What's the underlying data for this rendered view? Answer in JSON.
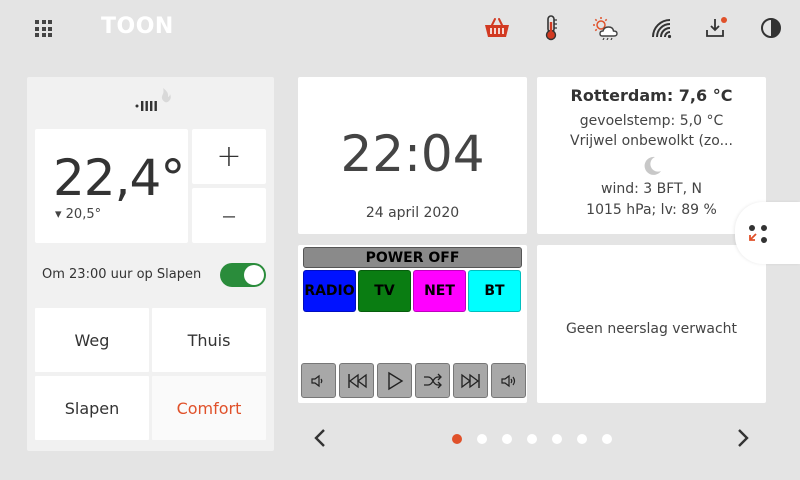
{
  "header": {
    "logo": "TOON",
    "icons": [
      "apps-grid-icon",
      "basket-icon",
      "thermometer-icon",
      "weather-icon",
      "wifi-icon",
      "download-icon",
      "contrast-icon"
    ],
    "notification_color": "#e0512a"
  },
  "thermostat": {
    "current_temp": "22,4°",
    "setpoint": "▾ 20,5°",
    "plus_label": "+",
    "minus_label": "–",
    "schedule_text": "Om 23:00 uur op Slapen",
    "schedule_enabled": true,
    "modes": {
      "weg": "Weg",
      "thuis": "Thuis",
      "slapen": "Slapen",
      "comfort": "Comfort"
    },
    "active_mode": "Comfort"
  },
  "clock": {
    "time": "22:04",
    "date": "24 april 2020"
  },
  "weather": {
    "city_line": "Rotterdam: 7,6 °C",
    "feels_like": "gevoelstemp: 5,0 °C",
    "condition": "Vrijwel onbewolkt (zo...",
    "wind": "wind: 3 BFT, N",
    "pressure": "1015 hPa; lv: 89 %"
  },
  "remote": {
    "power_label": "POWER OFF",
    "sources": {
      "radio": "RADIO",
      "tv": "TV",
      "net": "NET",
      "bt": "BT"
    },
    "source_colors": {
      "radio": "#0012ff",
      "tv": "#0a7d12",
      "net": "#ff00ff",
      "bt": "#00ffff"
    }
  },
  "rain": {
    "text": "Geen neerslag verwacht"
  },
  "pagination": {
    "pages": 7,
    "active_page": 1
  },
  "colors": {
    "accent": "#e0512a",
    "toggle_on": "#2a8c3b",
    "background": "#e4e4e4"
  }
}
